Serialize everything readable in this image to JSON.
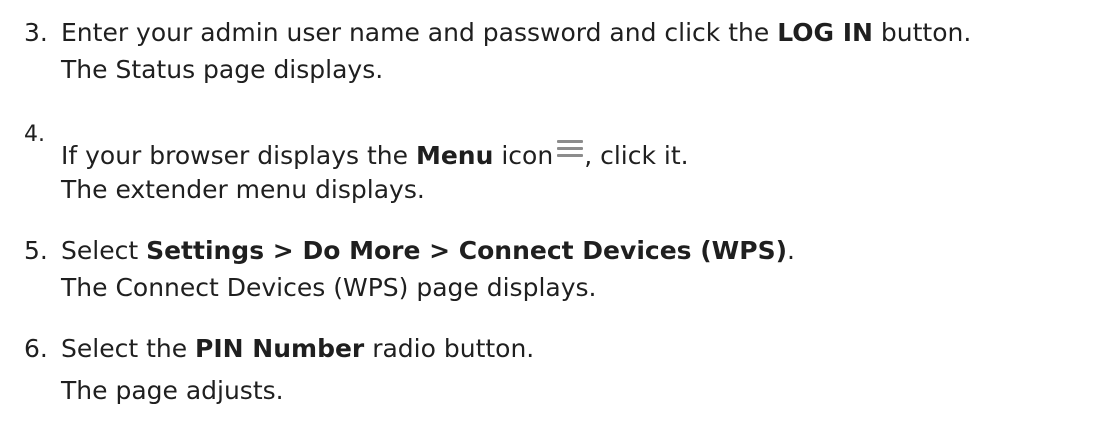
{
  "steps": [
    {
      "number": "3.",
      "text_before": "Enter your admin user name and password and click the ",
      "bold": "LOG IN",
      "text_after": " button.",
      "result": "The Status page displays."
    },
    {
      "number": "4.",
      "text_before": "If your browser displays the ",
      "bold": "Menu",
      "text_after": " icon",
      "icon": "menu-hamburger-icon",
      "text_after_icon": ", click it.",
      "result": "The extender menu displays."
    },
    {
      "number": "5.",
      "text_before": "Select ",
      "bold": "Settings > Do More > Connect Devices (WPS)",
      "text_after": ".",
      "result": "The Connect Devices (WPS) page displays."
    },
    {
      "number": "6.",
      "text_before": "Select the ",
      "bold": "PIN Number",
      "text_after": " radio button.",
      "result": "The page adjusts."
    }
  ],
  "colors": {
    "text": "#1f1f1f",
    "icon": "#8c8c8c"
  }
}
